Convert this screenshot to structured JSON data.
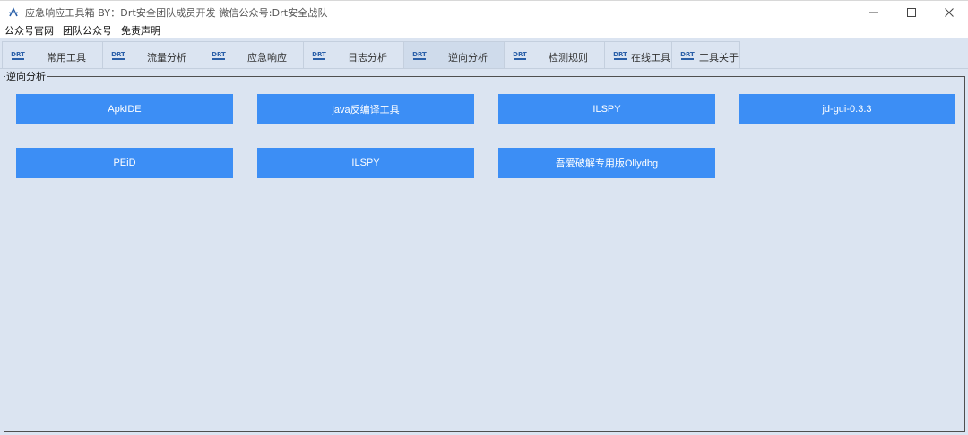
{
  "window": {
    "title": "应急响应工具箱   BY：Drt安全团队成员开发    微信公众号:Drt安全战队"
  },
  "menu": [
    "公众号官网",
    "团队公众号",
    "免责声明"
  ],
  "tabs": [
    {
      "label": "常用工具",
      "logo": "DRT"
    },
    {
      "label": "流量分析",
      "logo": "DRT"
    },
    {
      "label": "应急响应",
      "logo": "DRT"
    },
    {
      "label": "日志分析",
      "logo": "DRT"
    },
    {
      "label": "逆向分析",
      "logo": "DRT",
      "active": true
    },
    {
      "label": "检测规则",
      "logo": "DRT"
    },
    {
      "label": "在线工具",
      "logo": "DRT"
    },
    {
      "label": "工具关于",
      "logo": "DRT"
    }
  ],
  "group": {
    "title": "逆向分析"
  },
  "buttons": {
    "row1": [
      "ApkIDE",
      "java反编译工具",
      "ILSPY",
      "jd-gui-0.3.3"
    ],
    "row2": [
      "PEiD",
      "ILSPY",
      "吾爱破解专用版Ollydbg"
    ]
  },
  "colors": {
    "button_bg": "#3c8ef5",
    "client_bg": "#dbe4f1",
    "logo_blue": "#2a5fa8"
  },
  "icons": {
    "app": "app-icon",
    "minimize": "minimize-icon",
    "maximize": "maximize-icon",
    "close": "close-icon"
  }
}
